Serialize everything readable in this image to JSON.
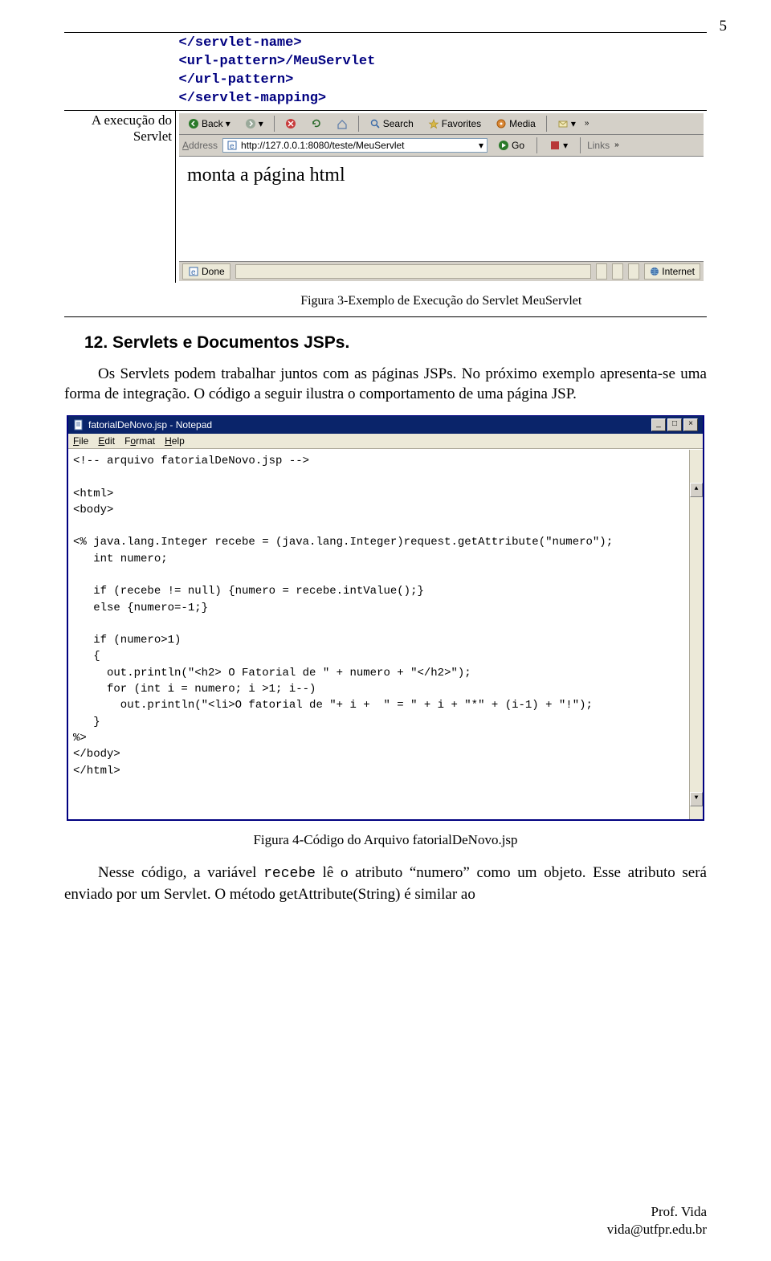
{
  "page_number": "5",
  "code_lines": [
    "</servlet-name>",
    "<url-pattern>/MeuServlet",
    "</url-pattern>",
    "</servlet-mapping>"
  ],
  "exec_label_1": "A execução do",
  "exec_label_2": "Servlet",
  "browser": {
    "back": "Back",
    "search": "Search",
    "favorites": "Favorites",
    "media": "Media",
    "addr_label": "Address",
    "url": "http://127.0.0.1:8080/teste/MeuServlet",
    "go": "Go",
    "links": "Links",
    "page_text": "monta a página html",
    "status_done": "Done",
    "status_zone": "Internet"
  },
  "figure3_caption": "Figura 3-Exemplo de Execução do Servlet MeuServlet",
  "heading": "12.  Servlets e Documentos JSPs.",
  "paragraph1": "Os Servlets podem trabalhar juntos com as páginas JSPs. No próximo exemplo apresenta‑se uma forma de integração. O código a seguir ilustra o comportamento de uma página JSP.",
  "notepad": {
    "title": "fatorialDeNovo.jsp - Notepad",
    "menu": [
      "File",
      "Edit",
      "Format",
      "Help"
    ],
    "code": "<!-- arquivo fatorialDeNovo.jsp -->\n\n<html>\n<body>\n\n<% java.lang.Integer recebe = (java.lang.Integer)request.getAttribute(\"numero\");\n   int numero;\n\n   if (recebe != null) {numero = recebe.intValue();}\n   else {numero=-1;}\n\n   if (numero>1)\n   {\n     out.println(\"<h2> O Fatorial de \" + numero + \"</h2>\");\n     for (int i = numero; i >1; i--)\n       out.println(\"<li>O fatorial de \"+ i +  \" = \" + i + \"*\" + (i-1) + \"!\");\n   }\n%>\n</body>\n</html>"
  },
  "figure4_caption": "Figura 4-Código do Arquivo fatorialDeNovo.jsp",
  "para2_a": "Nesse código, a variável ",
  "para2_code": "recebe",
  "para2_b": " lê o atributo “numero” como um objeto. Esse atributo será enviado por um Servlet.  O método getAttribute(String) é similar ao",
  "footer_name": "Prof. Vida",
  "footer_mail": "vida@utfpr.edu.br"
}
